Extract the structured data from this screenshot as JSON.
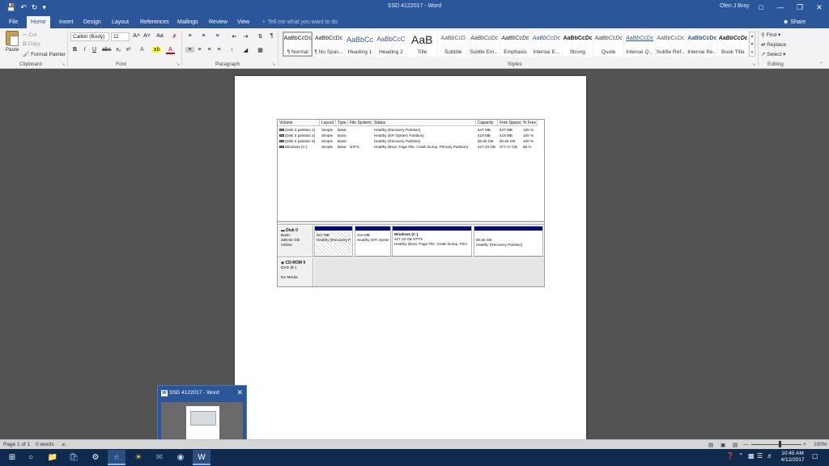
{
  "window": {
    "title": "SSD 4122017 - Word",
    "user": "Olen J Bray"
  },
  "tabs": [
    "File",
    "Home",
    "Insert",
    "Design",
    "Layout",
    "References",
    "Mailings",
    "Review",
    "View"
  ],
  "tell_me_placeholder": "Tell me what you want to do",
  "share_label": "Share",
  "clipboard": {
    "paste": "Paste",
    "cut": "Cut",
    "copy": "Copy",
    "format_painter": "Format Painter",
    "group_label": "Clipboard"
  },
  "font": {
    "family": "Calibri (Body)",
    "size": "11",
    "group_label": "Font"
  },
  "paragraph": {
    "group_label": "Paragraph"
  },
  "styles": {
    "group_label": "Styles",
    "items": [
      {
        "sample": "AaBbCcDc",
        "name": "¶ Normal"
      },
      {
        "sample": "AaBbCcDc",
        "name": "¶ No Spac..."
      },
      {
        "sample": "AaBbCc",
        "name": "Heading 1"
      },
      {
        "sample": "AaBbCcC",
        "name": "Heading 2"
      },
      {
        "sample": "AaB",
        "name": "Title"
      },
      {
        "sample": "AaBbCcD",
        "name": "Subtitle"
      },
      {
        "sample": "AaBbCcDc",
        "name": "Subtle Em..."
      },
      {
        "sample": "AaBbCcDc",
        "name": "Emphasis"
      },
      {
        "sample": "AaBbCcDc",
        "name": "Intense E..."
      },
      {
        "sample": "AaBbCcDc",
        "name": "Strong"
      },
      {
        "sample": "AaBbCcDc",
        "name": "Quote"
      },
      {
        "sample": "AaBbCcDc",
        "name": "Intense Q..."
      },
      {
        "sample": "AaBbCcDc",
        "name": "Subtle Ref..."
      },
      {
        "sample": "AaBbCcDc",
        "name": "Intense Re..."
      },
      {
        "sample": "AaBbCcDc",
        "name": "Book Title"
      }
    ]
  },
  "editing": {
    "find": "Find",
    "replace": "Replace",
    "select": "Select",
    "group_label": "Editing"
  },
  "disk_mgmt": {
    "headers": [
      "Volume",
      "Layout",
      "Type",
      "File System",
      "Status",
      "Capacity",
      "Free Space",
      "% Free"
    ],
    "rows": [
      [
        "(Disk 0 partition 1)",
        "Simple",
        "Basic",
        "",
        "Healthy (Recovery Partition)",
        "647 MB",
        "647 MB",
        "100 %"
      ],
      [
        "(Disk 0 partition 2)",
        "Simple",
        "Basic",
        "",
        "Healthy (EFI System Partition)",
        "419 MB",
        "419 MB",
        "100 %"
      ],
      [
        "(Disk 0 partition 5)",
        "Simple",
        "Basic",
        "",
        "Healthy (Recovery Partition)",
        "60.65 GB",
        "60.65 GB",
        "100 %"
      ],
      [
        "Windows (C:)",
        "Simple",
        "Basic",
        "NTFS",
        "Healthy (Boot, Page File, Crash Dump, Primary Partition)",
        "427.23 GB",
        "377.17 GB",
        "88 %"
      ]
    ],
    "disk0": {
      "name": "Disk 0",
      "type": "Basic",
      "size": "488.92 GB",
      "status": "Online",
      "partitions": [
        {
          "title": "",
          "line1": "647 MB",
          "line2": "Healthy (Recovery P"
        },
        {
          "title": "",
          "line1": "419 MB",
          "line2": "Healthy (EFI Syster"
        },
        {
          "title": "Windows (C:)",
          "line1": "427.23 GB NTFS",
          "line2": "Healthy (Boot, Page File, Crash Dump, Prim"
        },
        {
          "title": "",
          "line1": "60.65 GB",
          "line2": "Healthy (Recovery Partition)"
        }
      ]
    },
    "cdrom": {
      "name": "CD-ROM 0",
      "drive": "DVD (E:)",
      "media": "No Media"
    }
  },
  "thumbnail": {
    "title": "SSD 4122017 - Word"
  },
  "status": {
    "page": "Page 1 of 1",
    "words": "0 words",
    "zoom": "100%"
  },
  "clock": {
    "time": "10:45 AM",
    "date": "4/12/2017"
  },
  "colors": {
    "accent": "#2b579a",
    "taskbar": "#102a4d",
    "partition_bar": "#000a7a"
  }
}
